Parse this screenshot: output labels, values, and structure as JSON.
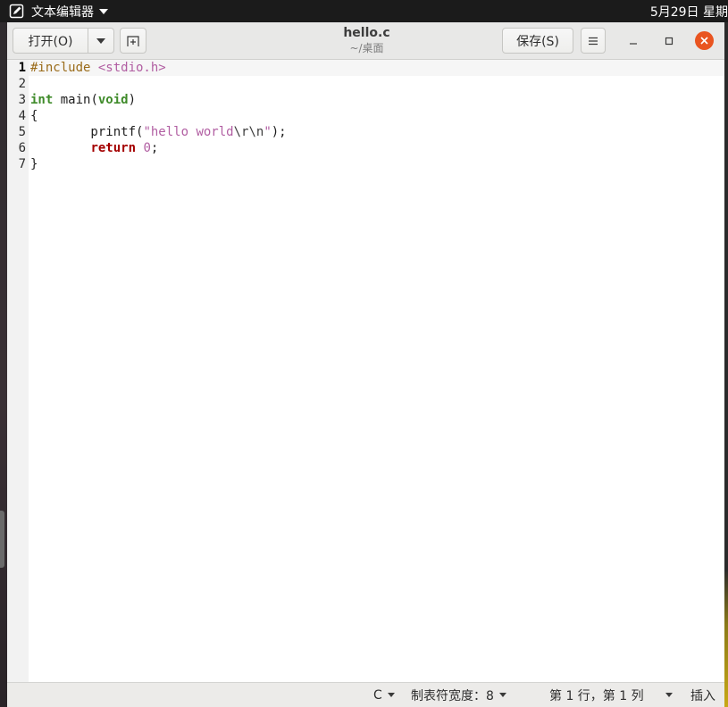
{
  "topbar": {
    "app_name": "文本编辑器",
    "clock": "5月29日 星期"
  },
  "header": {
    "open_label": "打开(O)",
    "title": "hello.c",
    "path": "~/桌面",
    "save_label": "保存(S)"
  },
  "editor": {
    "line_numbers": [
      "1",
      "2",
      "3",
      "4",
      "5",
      "6",
      "7"
    ],
    "current_line": 1,
    "lines": [
      [
        {
          "t": "#include ",
          "c": "pre"
        },
        {
          "t": "<stdio.h>",
          "c": "str"
        }
      ],
      [],
      [
        {
          "t": "int",
          "c": "type"
        },
        {
          "t": " main(",
          "c": ""
        },
        {
          "t": "void",
          "c": "type"
        },
        {
          "t": ")",
          "c": ""
        }
      ],
      [
        {
          "t": "{",
          "c": ""
        }
      ],
      [
        {
          "t": "        printf(",
          "c": ""
        },
        {
          "t": "\"hello world",
          "c": "str"
        },
        {
          "t": "\\r\\n",
          "c": "esc"
        },
        {
          "t": "\"",
          "c": "str"
        },
        {
          "t": ");",
          "c": ""
        }
      ],
      [
        {
          "t": "        ",
          "c": ""
        },
        {
          "t": "return",
          "c": "kw"
        },
        {
          "t": " ",
          "c": ""
        },
        {
          "t": "0",
          "c": "num"
        },
        {
          "t": ";",
          "c": ""
        }
      ],
      [
        {
          "t": "}",
          "c": ""
        }
      ]
    ]
  },
  "statusbar": {
    "language": "C",
    "tab_width": "制表符宽度：8",
    "cursor_position": "第 1 行，第 1 列",
    "insert_mode": "插入"
  },
  "colors": {
    "close_button": "#e95420",
    "keyword": "#a40000",
    "type": "#3f8b2a",
    "string": "#b15ea2",
    "preprocessor": "#9a6b19"
  },
  "icons": {
    "app": "text-editor-icon",
    "new_tab": "new-tab-icon",
    "menu": "hamburger-menu-icon",
    "minimize": "minimize-icon",
    "maximize": "maximize-icon",
    "close": "close-icon"
  }
}
